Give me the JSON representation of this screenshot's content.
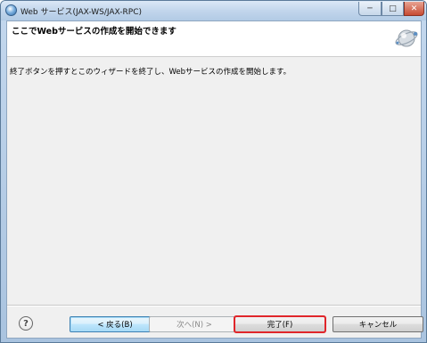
{
  "window": {
    "title": "Web サービス(JAX-WS/JAX-RPC)",
    "minimize_glyph": "─",
    "maximize_glyph": "□",
    "close_glyph": "✕"
  },
  "banner": {
    "title": "ここでWebサービスの作成を開始できます",
    "icon": "web-service-wizard-icon"
  },
  "content": {
    "message": "終了ボタンを押すとこのウィザードを終了し、Webサービスの作成を開始します。"
  },
  "footer": {
    "help_glyph": "?",
    "back_label": "< 戻る(B)",
    "next_label": "次へ(N) >",
    "finish_label": "完了(F)",
    "cancel_label": "キャンセル"
  },
  "colors": {
    "highlight_outline": "#e0262b",
    "focused_button_border": "#3c7fb1"
  }
}
